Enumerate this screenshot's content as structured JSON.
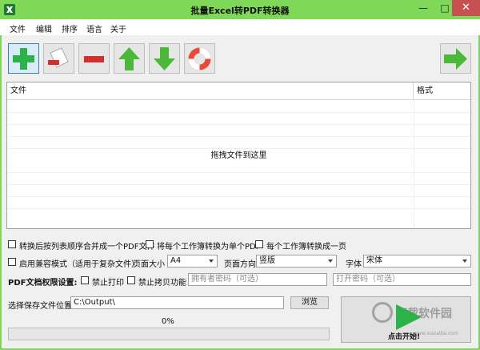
{
  "title": "批量Excel转PDF转换器",
  "window_controls": {
    "minimize": "—",
    "maximize": "□",
    "close": "✕"
  },
  "menu": [
    "文件",
    "编辑",
    "排序",
    "语言",
    "关于"
  ],
  "toolbar": {
    "buttons": [
      {
        "icon": "add-icon"
      },
      {
        "icon": "remove-file-icon"
      },
      {
        "icon": "clear-icon"
      },
      {
        "icon": "arrow-up-icon"
      },
      {
        "icon": "arrow-down-icon"
      },
      {
        "icon": "help-lifebuoy-icon"
      },
      {
        "icon": "next-arrow-icon"
      }
    ]
  },
  "file_list": {
    "columns": [
      "文件",
      "格式"
    ],
    "drop_hint": "拖拽文件到这里"
  },
  "options": {
    "merge_pdf": "转换后按列表顺序合并成一个PDF文件",
    "each_sheet_pdf": "将每个工作簿转换为单个PDF",
    "sheet_one_page": "每个工作簿转换成一页",
    "compat_mode": "启用兼容模式（适用于复杂文件）",
    "page_size_label": "页面大小",
    "page_size_value": "A4",
    "orientation_label": "页面方向",
    "orientation_value": "竖版",
    "font_label": "字体",
    "font_value": "宋体"
  },
  "permissions": {
    "label": "PDF文档权限设置:",
    "no_print": "禁止打印",
    "no_copy": "禁止拷贝功能",
    "owner_password_placeholder": "拥有者密码（可选）",
    "open_password_placeholder": "打开密码（可选）"
  },
  "output": {
    "label": "选择保存文件位置",
    "path": "C:\\Output\\",
    "browse": "浏览"
  },
  "progress": {
    "text": "0%",
    "value": 0
  },
  "start_button": {
    "label": "点击开始!"
  },
  "watermark": {
    "text": "下载软件园",
    "url": "www.xiazaiba.com"
  },
  "colors": {
    "titlebar": "#7fd857",
    "close": "#c75050",
    "play": "#2bb34a"
  }
}
